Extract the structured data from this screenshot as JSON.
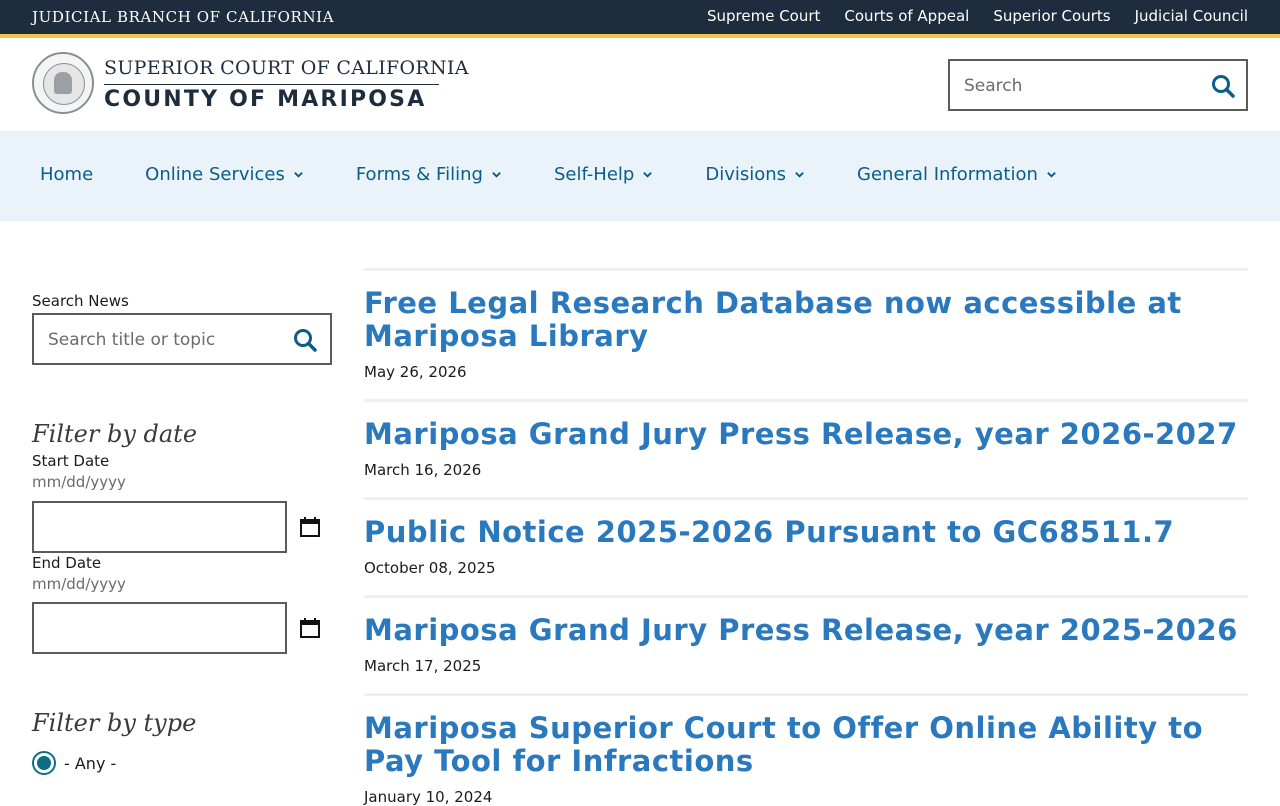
{
  "topbar": {
    "branch": "JUDICIAL BRANCH OF CALIFORNIA",
    "links": [
      "Supreme Court",
      "Courts of Appeal",
      "Superior Courts",
      "Judicial Council"
    ]
  },
  "header": {
    "line1": "SUPERIOR COURT OF CALIFORNIA",
    "line2": "COUNTY OF MARIPOSA",
    "search_placeholder": "Search"
  },
  "nav": [
    {
      "label": "Home",
      "dropdown": false
    },
    {
      "label": "Online Services",
      "dropdown": true
    },
    {
      "label": "Forms & Filing",
      "dropdown": true
    },
    {
      "label": "Self-Help",
      "dropdown": true
    },
    {
      "label": "Divisions",
      "dropdown": true
    },
    {
      "label": "General Information",
      "dropdown": true
    }
  ],
  "sidebar": {
    "search_label": "Search News",
    "search_placeholder": "Search title or topic",
    "filter_date_heading": "Filter by date",
    "start_label": "Start Date",
    "start_hint": "mm/dd/yyyy",
    "end_label": "End Date",
    "end_hint": "mm/dd/yyyy",
    "filter_type_heading": "Filter by type",
    "type_option": "- Any -"
  },
  "news": [
    {
      "title": "Free Legal Research Database now accessible at Mariposa Library",
      "date": "May 26, 2026"
    },
    {
      "title": "Mariposa Grand Jury Press Release, year 2026-2027",
      "date": "March 16, 2026"
    },
    {
      "title": "Public Notice 2025-2026 Pursuant to GC68511.7",
      "date": "October 08, 2025"
    },
    {
      "title": "Mariposa Grand Jury Press Release, year 2025-2026",
      "date": "March 17, 2025"
    },
    {
      "title": "Mariposa Superior Court to Offer Online Ability to Pay Tool for Infractions",
      "date": "January 10, 2024"
    }
  ],
  "colors": {
    "topbar_bg": "#1e2d3d",
    "accent_gold": "#f3c54a",
    "nav_bg": "#eaf3fa",
    "link_blue": "#2a78bd",
    "radio_teal": "#0b6e85"
  }
}
